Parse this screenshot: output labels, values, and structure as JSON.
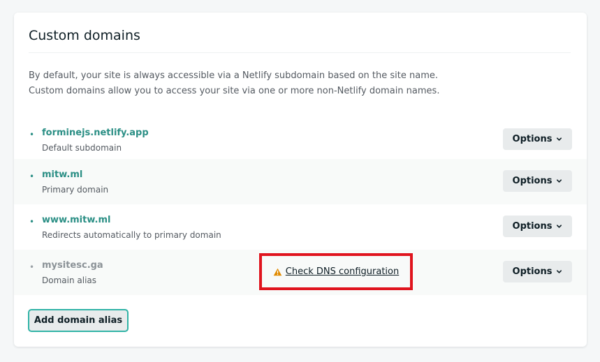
{
  "title": "Custom domains",
  "description": {
    "line1": "By default, your site is always accessible via a Netlify subdomain based on the site name.",
    "line2": "Custom domains allow you to access your site via one or more non-Netlify domain names."
  },
  "domains": [
    {
      "name": "forminejs.netlify.app",
      "subtitle": "Default subdomain",
      "options_label": "Options"
    },
    {
      "name": "mitw.ml",
      "subtitle": "Primary domain",
      "options_label": "Options"
    },
    {
      "name": "www.mitw.ml",
      "subtitle": "Redirects automatically to primary domain",
      "options_label": "Options"
    },
    {
      "name": "mysitesc.ga",
      "subtitle": "Domain alias",
      "options_label": "Options",
      "warning_link": "Check DNS configuration"
    }
  ],
  "add_alias_label": "Add domain alias",
  "bullet": "•",
  "icons": {
    "chevron": "chevron-down-icon",
    "warning": "warning-triangle-icon"
  },
  "colors": {
    "accent": "#2b8f85",
    "muted": "#8b9297",
    "button_bg": "#e8ebec",
    "highlight_border": "#e0141e",
    "warning": "#e08a00",
    "focus_border": "#30b3a6"
  }
}
